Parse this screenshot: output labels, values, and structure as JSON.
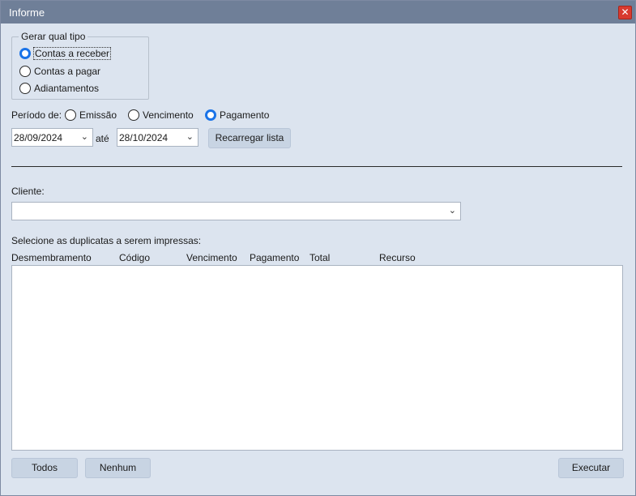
{
  "window": {
    "title": "Informe",
    "close_glyph": "✕"
  },
  "group": {
    "legend": "Gerar qual tipo",
    "options": [
      {
        "label": "Contas a receber",
        "selected": true
      },
      {
        "label": "Contas a pagar",
        "selected": false
      },
      {
        "label": "Adiantamentos",
        "selected": false
      }
    ]
  },
  "periodo": {
    "label": "Período de:",
    "options": [
      {
        "label": "Emissão",
        "selected": false
      },
      {
        "label": "Vencimento",
        "selected": false
      },
      {
        "label": "Pagamento",
        "selected": true
      }
    ],
    "date_from": "28/09/2024",
    "ate_label": "até",
    "date_to": "28/10/2024",
    "reload_label": "Recarregar lista"
  },
  "cliente": {
    "label": "Cliente:",
    "value": ""
  },
  "duplicatas": {
    "label": "Selecione as duplicatas a serem impressas:",
    "columns": [
      "Desmembramento",
      "Código",
      "Vencimento",
      "Pagamento",
      "Total",
      "Recurso"
    ],
    "rows": []
  },
  "footer": {
    "todos_label": "Todos",
    "nenhum_label": "Nenhum",
    "executar_label": "Executar"
  },
  "colors": {
    "accent": "#1a73e8",
    "titlebar": "#6f7f98",
    "close": "#d83a2f",
    "background": "#dce4ef"
  },
  "icons": {
    "dropdown": "chevron-down-icon",
    "close": "close-icon"
  }
}
